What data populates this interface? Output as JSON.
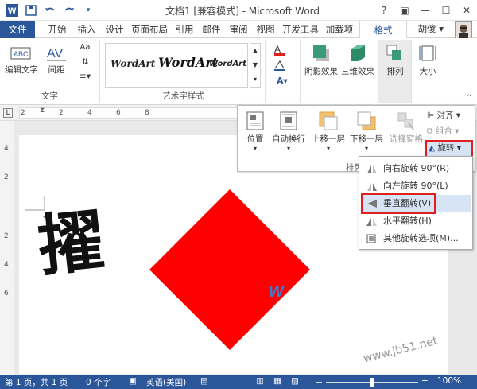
{
  "window": {
    "title": "文档1 [兼容模式] - Microsoft Word",
    "help": "?",
    "ctrl_restore": "▣",
    "ctrl_min": "—",
    "ctrl_max": "☐",
    "ctrl_close": "✕"
  },
  "qat": {
    "save_icon": "save-icon",
    "undo_icon": "undo-icon",
    "redo_icon": "redo-icon"
  },
  "tabs": [
    "文件",
    "开始",
    "插入",
    "设计",
    "页面布局",
    "引用",
    "邮件",
    "审阅",
    "视图",
    "开发工具",
    "加载项",
    "格式"
  ],
  "user": "胡傻 ▾",
  "ribbon": {
    "text_group": {
      "label": "文字",
      "edit_text": "编辑文字",
      "spacing": "间距",
      "aa": "Aa"
    },
    "wordart_group": {
      "label": "艺术字样式",
      "samples": [
        "WordArt",
        "WordArt",
        "WordArt"
      ]
    },
    "effects": {
      "shadow": "阴影效果",
      "threed": "三维效果",
      "arrange": "排列",
      "size": "大小"
    }
  },
  "ruler": {
    "ticks": [
      "2",
      "2",
      "4",
      "6",
      "8"
    ],
    "left_ticks": [
      "4",
      "2",
      "2",
      "4",
      "6"
    ]
  },
  "arrange_popup": {
    "position": "位置",
    "wrap": "自动换行",
    "forward": "上移一层",
    "backward": "下移一层",
    "selection_pane": "选择窗格",
    "align": "对齐",
    "group": "组合",
    "rotate": "旋转",
    "label": "排列"
  },
  "rotate_menu": [
    {
      "label": "向右旋转 90°(R)",
      "icon": "rotate-right-icon"
    },
    {
      "label": "向左旋转 90°(L)",
      "icon": "rotate-left-icon"
    },
    {
      "label": "垂直翻转(V)",
      "icon": "flip-vertical-icon"
    },
    {
      "label": "水平翻转(H)",
      "icon": "flip-horizontal-icon"
    },
    {
      "label": "其他旋转选项(M)...",
      "icon": "rotation-options-icon"
    }
  ],
  "document": {
    "calligraphy": "擢",
    "shape_color": "#ff0000",
    "wordart_fragment": "W",
    "return_mark": "↵"
  },
  "watermark": "www.jb51.net",
  "status": {
    "page": "第 1 页，共 1 页",
    "words": "0 个字",
    "lang": "英语(美国)",
    "zoom": "100%",
    "zoom_minus": "－",
    "zoom_plus": "+"
  },
  "colors": {
    "accent": "#2b579a",
    "highlight": "#e02020"
  }
}
